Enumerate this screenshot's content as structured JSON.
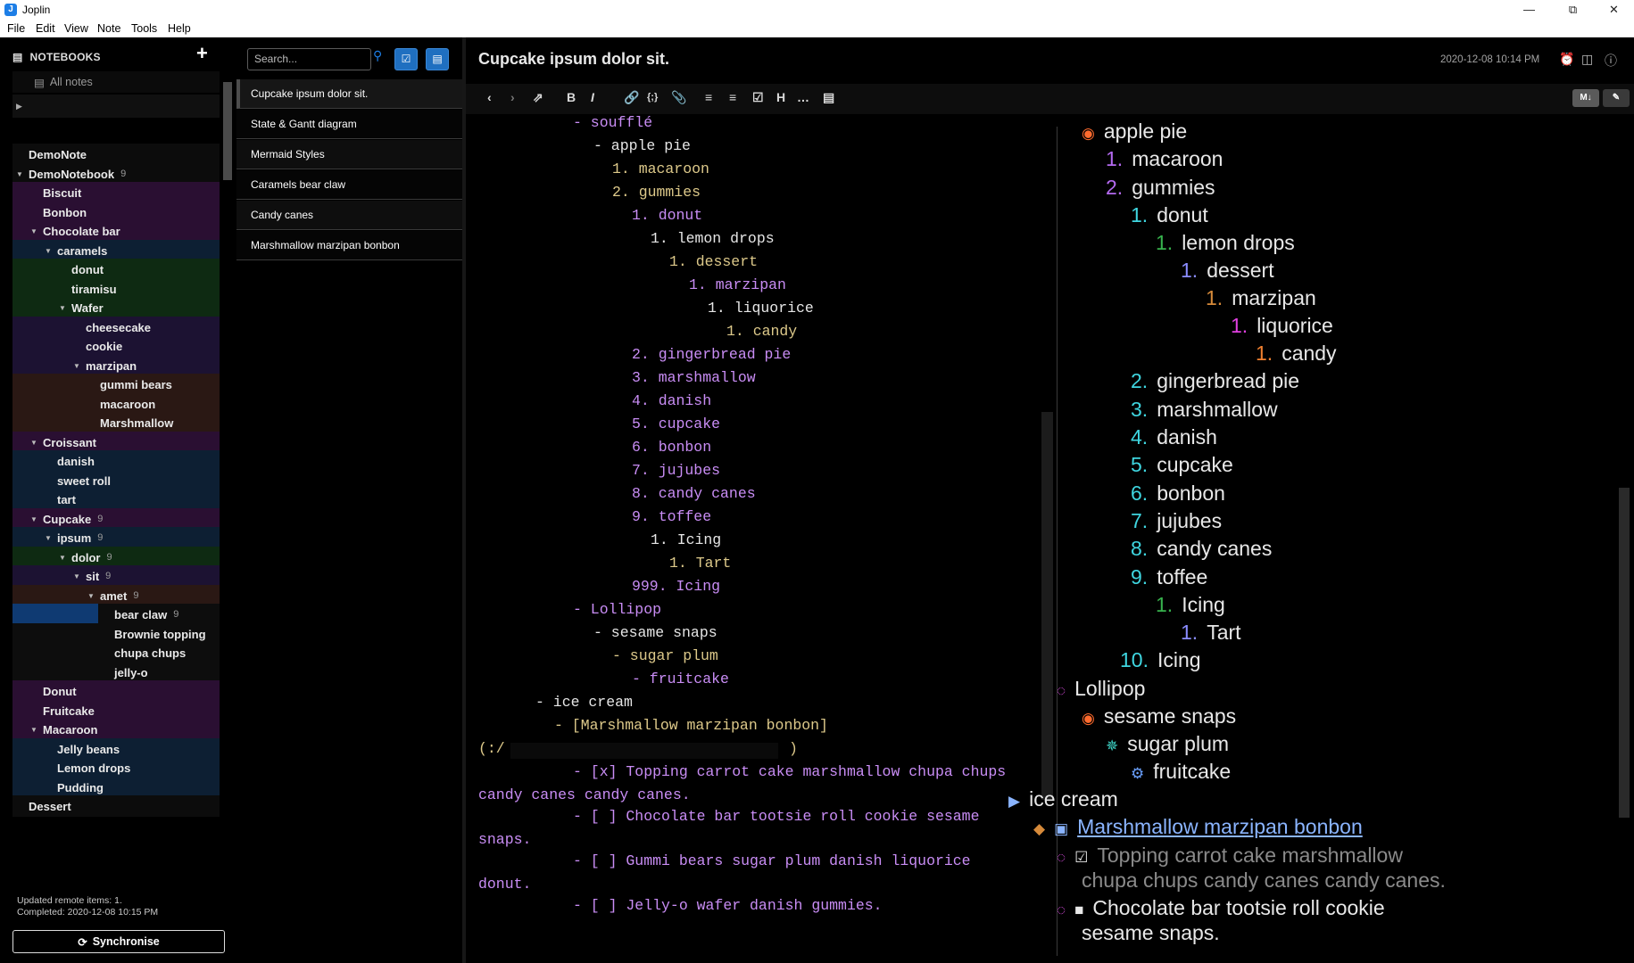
{
  "window": {
    "title": "Joplin",
    "app_letter": "J"
  },
  "menu": [
    "File",
    "Edit",
    "View",
    "Note",
    "Tools",
    "Help"
  ],
  "sidebar": {
    "header": "NOTEBOOKS",
    "all_notes": "All notes",
    "notebooks": [
      {
        "label": "DemoNote",
        "count": ""
      },
      {
        "label": "DemoNotebook",
        "count": "9"
      },
      {
        "label": "Biscuit",
        "count": ""
      },
      {
        "label": "Bonbon",
        "count": ""
      },
      {
        "label": "Chocolate bar",
        "count": ""
      },
      {
        "label": "caramels",
        "count": ""
      },
      {
        "label": "donut",
        "count": ""
      },
      {
        "label": "tiramisu",
        "count": ""
      },
      {
        "label": "Wafer",
        "count": ""
      },
      {
        "label": "cheesecake",
        "count": ""
      },
      {
        "label": "cookie",
        "count": ""
      },
      {
        "label": "marzipan",
        "count": ""
      },
      {
        "label": "gummi bears",
        "count": ""
      },
      {
        "label": "macaroon",
        "count": ""
      },
      {
        "label": "Marshmallow",
        "count": ""
      },
      {
        "label": "Croissant",
        "count": ""
      },
      {
        "label": "danish",
        "count": ""
      },
      {
        "label": "sweet roll",
        "count": ""
      },
      {
        "label": "tart",
        "count": ""
      },
      {
        "label": "Cupcake",
        "count": "9"
      },
      {
        "label": "ipsum",
        "count": "9"
      },
      {
        "label": "dolor",
        "count": "9"
      },
      {
        "label": "sit",
        "count": "9"
      },
      {
        "label": "amet",
        "count": "9"
      },
      {
        "label": "bear claw",
        "count": "9"
      },
      {
        "label": "Brownie topping",
        "count": ""
      },
      {
        "label": "chupa chups",
        "count": ""
      },
      {
        "label": "jelly-o",
        "count": ""
      },
      {
        "label": "Donut",
        "count": ""
      },
      {
        "label": "Fruitcake",
        "count": ""
      },
      {
        "label": "Macaroon",
        "count": ""
      },
      {
        "label": "Jelly beans",
        "count": ""
      },
      {
        "label": "Lemon drops",
        "count": ""
      },
      {
        "label": "Pudding",
        "count": ""
      },
      {
        "label": "Dessert",
        "count": ""
      }
    ],
    "status_line1": "Updated remote items: 1.",
    "status_line2": "Completed: 2020-12-08 10:15 PM",
    "sync_label": "Synchronise"
  },
  "notelist": {
    "search_placeholder": "Search...",
    "notes": [
      "Cupcake ipsum dolor sit.",
      "State & Gantt diagram",
      "Mermaid Styles",
      "Caramels bear claw",
      "Candy canes",
      "Marshmallow marzipan bonbon"
    ]
  },
  "note": {
    "title": "Cupcake ipsum dolor sit.",
    "date": "2020-12-08 10:14 PM"
  },
  "colors": {
    "accent": "#1d7ee6",
    "md_purple": "#c98df5",
    "md_yellow": "#ddc98a",
    "link": "#8ab4ff"
  },
  "editor": {
    "lines": [
      "- soufflé",
      "- apple pie",
      "1. macaroon",
      "2. gummies",
      "1. donut",
      "1. lemon drops",
      "1. dessert",
      "1. marzipan",
      "1. liquorice",
      "1. candy",
      "2. gingerbread pie",
      "3. marshmallow",
      "4. danish",
      "5. cupcake",
      "6. bonbon",
      "7. jujubes",
      "8. candy canes",
      "9. toffee",
      "1. Icing",
      "1. Tart",
      "999. Icing",
      "- Lollipop",
      "- sesame snaps",
      "- sugar plum",
      "- fruitcake",
      "- ice cream",
      "- [Marshmallow marzipan bonbon]",
      "(:/",
      ")",
      "- [x] Topping carrot cake marshmallow chupa chups",
      "candy canes candy canes.",
      "- [ ] Chocolate bar tootsie roll cookie sesame",
      "snaps.",
      "- [ ] Gummi bears sugar plum danish liquorice",
      "donut.",
      "- [ ] Jelly-o wafer danish gummies."
    ]
  },
  "viewer": {
    "items": [
      {
        "bullet": "",
        "text": "apple pie"
      },
      {
        "bullet": "1.",
        "text": "macaroon"
      },
      {
        "bullet": "2.",
        "text": "gummies"
      },
      {
        "bullet": "1.",
        "text": "donut"
      },
      {
        "bullet": "1.",
        "text": "lemon drops"
      },
      {
        "bullet": "1.",
        "text": "dessert"
      },
      {
        "bullet": "1.",
        "text": "marzipan"
      },
      {
        "bullet": "1.",
        "text": "liquorice"
      },
      {
        "bullet": "1.",
        "text": "candy"
      },
      {
        "bullet": "2.",
        "text": "gingerbread pie"
      },
      {
        "bullet": "3.",
        "text": "marshmallow"
      },
      {
        "bullet": "4.",
        "text": "danish"
      },
      {
        "bullet": "5.",
        "text": "cupcake"
      },
      {
        "bullet": "6.",
        "text": "bonbon"
      },
      {
        "bullet": "7.",
        "text": "jujubes"
      },
      {
        "bullet": "8.",
        "text": "candy canes"
      },
      {
        "bullet": "9.",
        "text": "toffee"
      },
      {
        "bullet": "1.",
        "text": "Icing"
      },
      {
        "bullet": "1.",
        "text": "Tart"
      },
      {
        "bullet": "10.",
        "text": "Icing"
      },
      {
        "bullet": "",
        "text": "Lollipop"
      },
      {
        "bullet": "",
        "text": "sesame snaps"
      },
      {
        "bullet": "",
        "text": "sugar plum"
      },
      {
        "bullet": "",
        "text": "fruitcake"
      },
      {
        "bullet": "",
        "text": "ice cream"
      },
      {
        "bullet": "",
        "text": "Marshmallow marzipan bonbon"
      },
      {
        "bullet": "",
        "text": "Topping carrot cake marshmallow"
      },
      {
        "bullet": "",
        "text": "chupa chups candy canes candy canes."
      },
      {
        "bullet": "",
        "text": "Chocolate bar tootsie roll cookie"
      },
      {
        "bullet": "",
        "text": "sesame snaps."
      }
    ]
  }
}
